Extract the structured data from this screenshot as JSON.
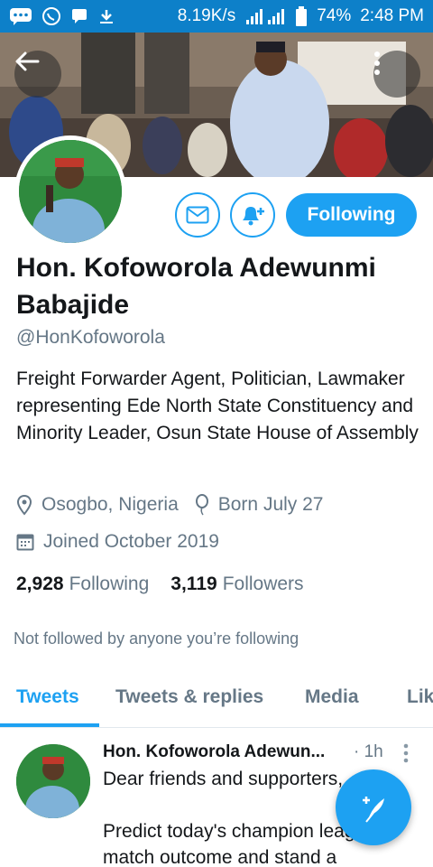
{
  "status_bar": {
    "network_speed": "8.19K/s",
    "battery": "74%",
    "time": "2:48 PM"
  },
  "profile": {
    "name": "Hon. Kofoworola Adewunmi Babajide",
    "handle": "@HonKofoworola",
    "bio": "Freight Forwarder Agent, Politician, Lawmaker representing Ede North State Constituency and Minority Leader, Osun State House of Assembly",
    "location": "Osogbo, Nigeria",
    "birthday": "Born July 27",
    "joined": "Joined October 2019",
    "following_count": "2,928",
    "following_label": "Following",
    "followers_count": "3,119",
    "followers_label": "Followers",
    "not_followed_text": "Not followed by anyone you’re following"
  },
  "actions": {
    "follow_label": "Following",
    "message_icon": "mail-icon",
    "notify_icon": "bell-plus-icon"
  },
  "tabs": [
    {
      "label": "Tweets",
      "active": true
    },
    {
      "label": "Tweets & replies",
      "active": false
    },
    {
      "label": "Media",
      "active": false
    },
    {
      "label": "Lik",
      "active": false
    }
  ],
  "tweet": {
    "author": "Hon. Kofoworola Adewun...",
    "time": "· 1h",
    "line1": "Dear friends and supporters,",
    "line2": "Predict today's champion leag",
    "line3": "match outcome and stand a"
  },
  "colors": {
    "accent": "#1da1f2",
    "status_bar": "#0d80c9",
    "secondary_text": "#657786"
  }
}
